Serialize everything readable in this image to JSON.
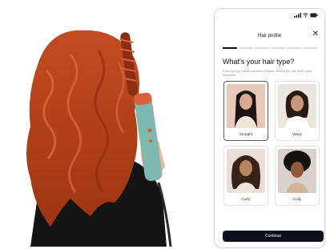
{
  "profile": {
    "title": "Hair profile",
    "close_icon": "close-icon",
    "progress_total": 6,
    "progress_done": 1,
    "question": "What's your hair type?",
    "subtitle": "If you feel you have a mixture of types, choose the one that's most dominant",
    "options": [
      {
        "label": "Straight",
        "selected": true
      },
      {
        "label": "Wavy",
        "selected": false
      },
      {
        "label": "Curly",
        "selected": false
      },
      {
        "label": "Coily",
        "selected": false
      }
    ],
    "continue_label": "Continue"
  },
  "colors": {
    "hair": "#b8431c",
    "button": "#0d0f1a",
    "styler_body": "#7fb8ae",
    "styler_accent": "#d9603a"
  }
}
